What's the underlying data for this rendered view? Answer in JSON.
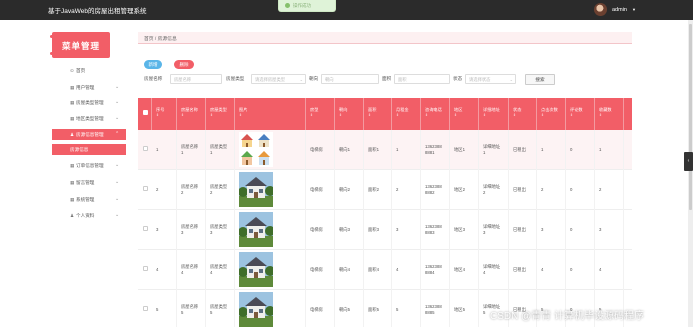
{
  "header": {
    "app_title": "基于JavaWeb的房屋出租管理系统",
    "toast": "操作成功",
    "username": "admin"
  },
  "sidebar": {
    "title": "菜单管理",
    "items": [
      {
        "label": "首页",
        "icon": "home-icon"
      },
      {
        "label": "用户管理",
        "icon": "grid-icon"
      },
      {
        "label": "房屋类型管理",
        "icon": "grid-icon"
      },
      {
        "label": "地区类型管理",
        "icon": "grid-icon"
      },
      {
        "label": "房源信息管理",
        "icon": "user-icon",
        "active": true
      },
      {
        "label": "房源信息",
        "sub": true
      },
      {
        "label": "订单信息管理",
        "icon": "grid-icon"
      },
      {
        "label": "留言管理",
        "icon": "grid-icon"
      },
      {
        "label": "系统管理",
        "icon": "grid-icon"
      },
      {
        "label": "个人资料",
        "icon": "user-icon"
      }
    ]
  },
  "breadcrumb": "首页 / 房源信息",
  "toolbar": {
    "add_label": "新增",
    "delete_label": "删除"
  },
  "filters": {
    "name_label": "房屋名称",
    "name_placeholder": "房屋名称",
    "type_label": "房屋类型",
    "type_placeholder": "请选择房屋类型",
    "orientation_label": "朝向",
    "orientation_placeholder": "朝向",
    "area_label": "面积",
    "area_placeholder": "面积",
    "status_label": "状态",
    "status_placeholder": "请选择状态",
    "search_label": "搜索"
  },
  "table": {
    "columns": [
      "序号",
      "房屋名称",
      "房屋类型",
      "图片",
      "房型",
      "朝向",
      "面积",
      "月租金",
      "咨询电话",
      "地区",
      "详细地址",
      "状态",
      "点击次数",
      "评论数",
      "收藏数"
    ],
    "rows": [
      {
        "no": "1",
        "name": "房屋名称\n1",
        "type": "房屋类型\n1",
        "img": "houses-clipart",
        "layout": "电梯房",
        "orient": "朝向1",
        "area": "面积1",
        "rent": "1",
        "phone": "1362388\n8881",
        "region": "地区1",
        "addr": "详细地址\n1",
        "status": "已租出",
        "clicks": "1",
        "comments": "0",
        "favs": "1"
      },
      {
        "no": "2",
        "name": "房屋名称\n2",
        "type": "房屋类型\n2",
        "img": "house-photo",
        "layout": "电梯房",
        "orient": "朝向2",
        "area": "面积2",
        "rent": "2",
        "phone": "1362388\n8882",
        "region": "地区2",
        "addr": "详细地址\n2",
        "status": "已租出",
        "clicks": "2",
        "comments": "0",
        "favs": "2"
      },
      {
        "no": "3",
        "name": "房屋名称\n3",
        "type": "房屋类型\n3",
        "img": "house-photo",
        "layout": "电梯房",
        "orient": "朝向3",
        "area": "面积3",
        "rent": "3",
        "phone": "1362388\n8883",
        "region": "地区3",
        "addr": "详细地址\n3",
        "status": "已租出",
        "clicks": "3",
        "comments": "0",
        "favs": "3"
      },
      {
        "no": "4",
        "name": "房屋名称\n4",
        "type": "房屋类型\n4",
        "img": "house-photo",
        "layout": "电梯房",
        "orient": "朝向4",
        "area": "面积4",
        "rent": "4",
        "phone": "1362388\n8884",
        "region": "地区4",
        "addr": "详细地址\n4",
        "status": "已租出",
        "clicks": "4",
        "comments": "0",
        "favs": "4"
      },
      {
        "no": "5",
        "name": "房屋名称\n5",
        "type": "房屋类型\n5",
        "img": "house-photo",
        "layout": "电梯房",
        "orient": "朝向5",
        "area": "面积5",
        "rent": "5",
        "phone": "1362388\n8885",
        "region": "地区5",
        "addr": "详细地址\n5",
        "status": "已租出",
        "clicks": "5",
        "comments": "0",
        "favs": "5"
      }
    ]
  },
  "watermark": "CSDN @青青    计算机毕设源码程序",
  "colors": {
    "accent": "#f25e67",
    "info": "#5ab5e8",
    "topbar": "#2b2b2b"
  }
}
